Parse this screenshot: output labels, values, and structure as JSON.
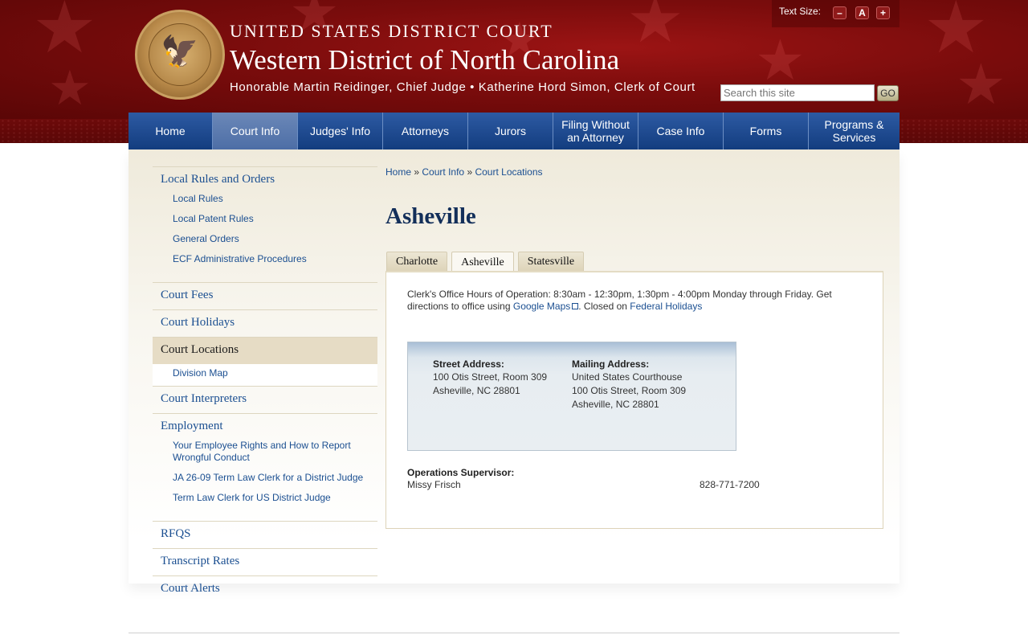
{
  "header": {
    "line1": "UNITED STATES DISTRICT COURT",
    "line2": "Western District of North Carolina",
    "line3": "Honorable Martin Reidinger, Chief Judge • Katherine Hord Simon, Clerk of Court",
    "text_size_label": "Text Size:",
    "text_size_buttons": [
      "–",
      "A",
      "+"
    ],
    "search_placeholder": "Search this site",
    "go_label": "GO"
  },
  "nav": {
    "items": [
      {
        "label": "Home"
      },
      {
        "label": "Court Info"
      },
      {
        "label": "Judges' Info"
      },
      {
        "label": "Attorneys"
      },
      {
        "label": "Jurors"
      },
      {
        "label": "Filing Without an Attorney"
      },
      {
        "label": "Case Info"
      },
      {
        "label": "Forms"
      },
      {
        "label": "Programs & Services"
      }
    ],
    "active": "Court Info"
  },
  "sidebar": {
    "local_rules": {
      "label": "Local Rules and Orders",
      "children": [
        "Local Rules",
        "Local Patent Rules",
        "General Orders",
        "ECF Administrative Procedures"
      ]
    },
    "court_fees": "Court Fees",
    "court_holidays": "Court Holidays",
    "court_locations": {
      "label": "Court Locations",
      "children": [
        "Division Map"
      ]
    },
    "court_interpreters": "Court Interpreters",
    "employment": {
      "label": "Employment",
      "children": [
        "Your Employee Rights and How to Report Wrongful Conduct",
        "JA 26-09 Term Law Clerk for a District Judge",
        "Term Law Clerk for US District Judge"
      ]
    },
    "rfqs": "RFQS",
    "transcript_rates": "Transcript Rates",
    "court_alerts": "Court Alerts"
  },
  "breadcrumb": {
    "home": "Home",
    "sep": "»",
    "court_info": "Court Info",
    "current": "Court Locations"
  },
  "page": {
    "title": "Asheville"
  },
  "tabs": [
    {
      "label": "Charlotte"
    },
    {
      "label": "Asheville"
    },
    {
      "label": "Statesville"
    }
  ],
  "panel": {
    "hours_text": "Clerk's Office Hours of Operation: 8:30am - 12:30pm, 1:30pm - 4:00pm Monday through Friday. Get directions to office using",
    "google_maps": "Google Maps",
    "closed_on": ". Closed on",
    "federal_holidays": "Federal Holidays",
    "street": {
      "head": "Street Address:",
      "line1": "100 Otis Street, Room 309",
      "line2": "Asheville, NC  28801"
    },
    "mailing": {
      "head": "Mailing Address:",
      "line1": "United States Courthouse",
      "line2": "100 Otis Street, Room 309",
      "line3": "Asheville, NC  28801"
    },
    "ops_head": "Operations Supervisor:",
    "ops_name": "Missy Frisch",
    "ops_phone": "828-771-7200"
  }
}
